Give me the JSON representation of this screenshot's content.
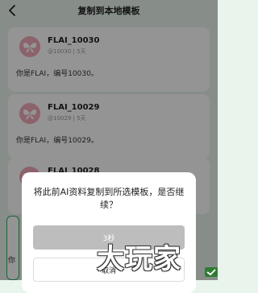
{
  "header": {
    "title": "复制到本地模板"
  },
  "cards": [
    {
      "name": "FLAI_10030",
      "meta": "@10030 | 5天",
      "description": "你是FLAI，编号10030。"
    },
    {
      "name": "FLAI_10029",
      "meta": "@10029 | 5天",
      "description": "你是FLAI，编号10029。"
    },
    {
      "name": "FLAI_10028"
    }
  ],
  "peek_text": "你",
  "dialog": {
    "message": "将此前AI资料复制到所选模板，是否继续？",
    "confirm_label": "3秒",
    "cancel_label": "取消"
  },
  "watermark": "大玩家",
  "colors": {
    "background": "#e9f5ec",
    "accent": "#27ae60",
    "avatar": "#f1a9b8",
    "confirm_disabled": "#bdbdbd"
  }
}
